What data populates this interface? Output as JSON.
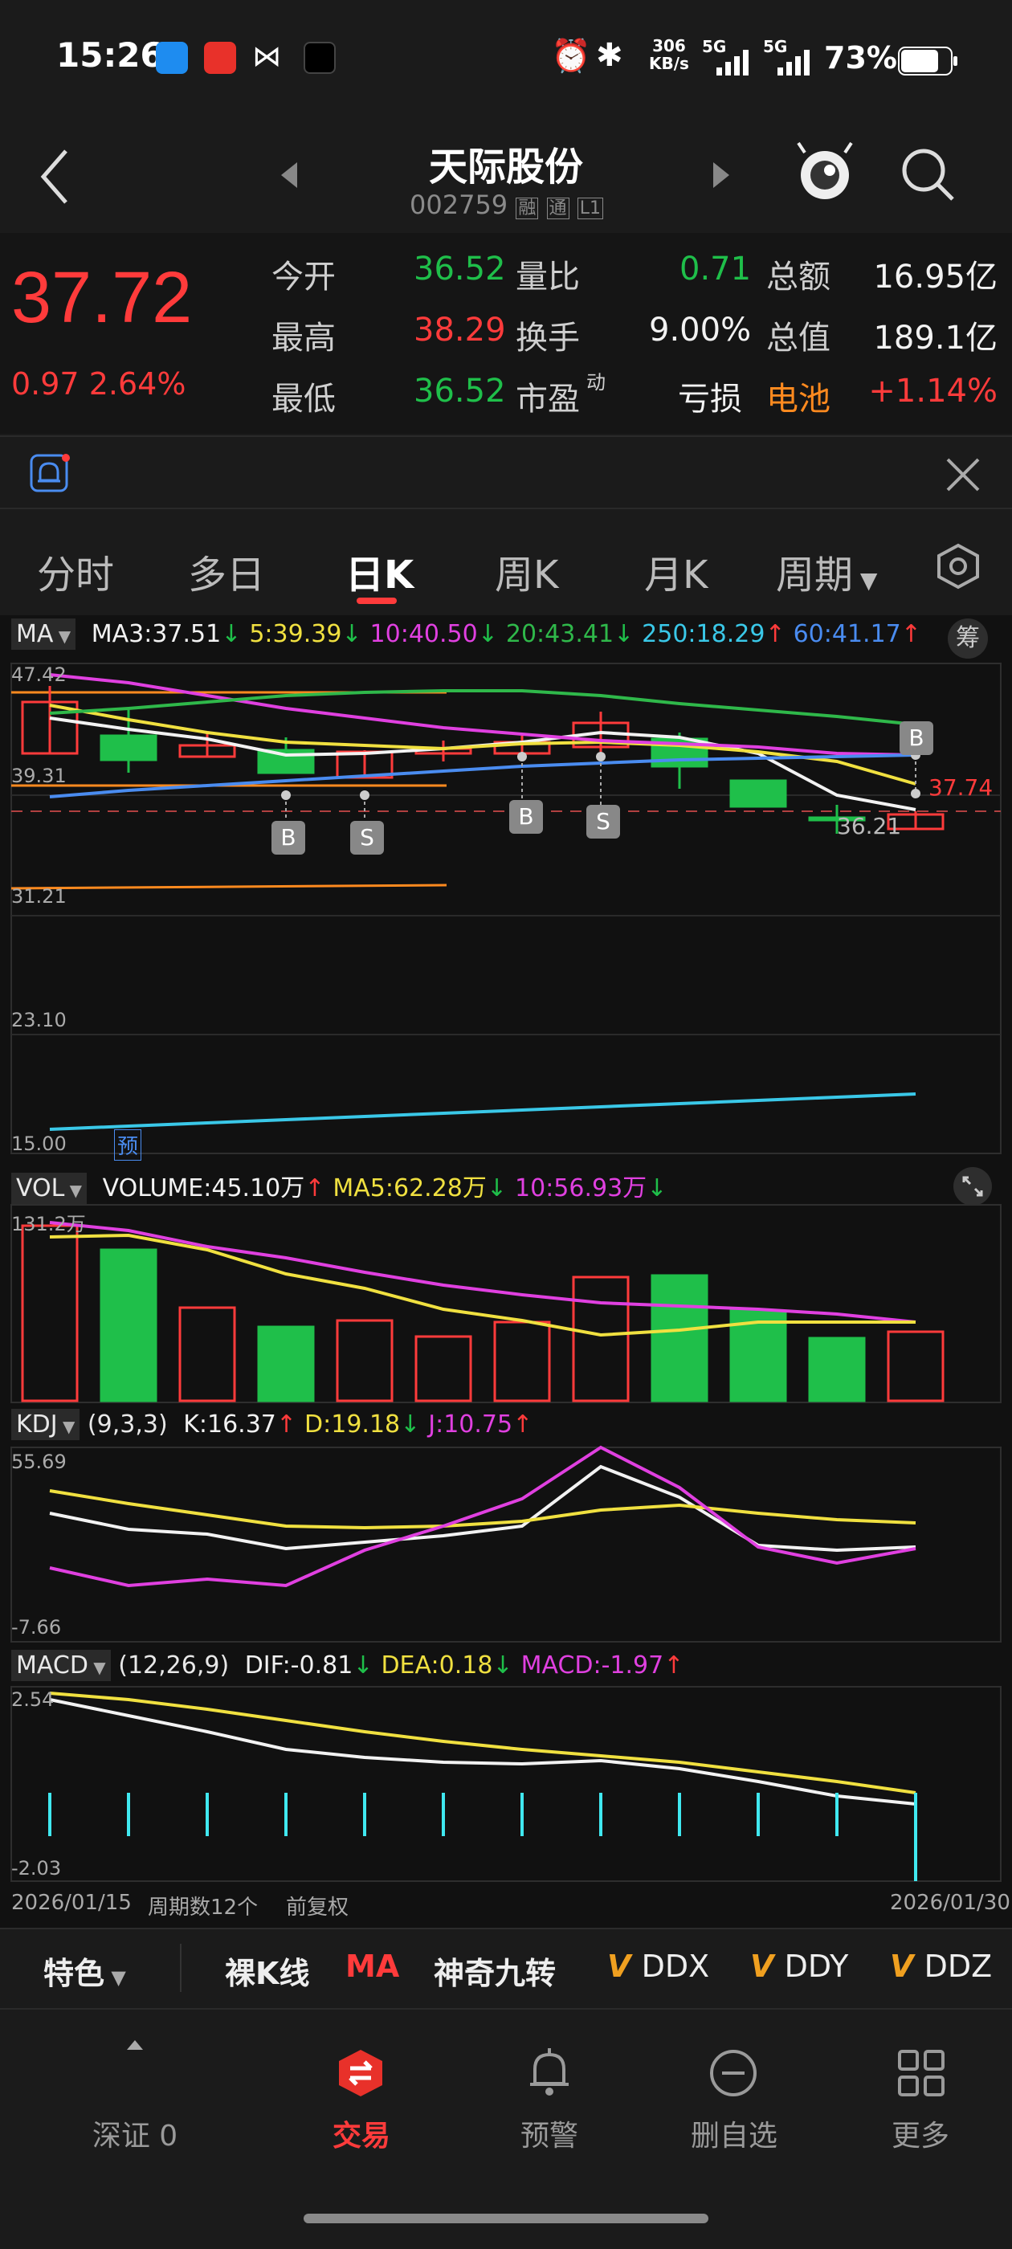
{
  "status": {
    "time": "15:26",
    "speed_top": "306",
    "speed_bottom": "KB/s",
    "net1": "5G",
    "net2": "5G",
    "battery": "73%"
  },
  "header": {
    "title": "天际股份",
    "code": "002759",
    "badge1": "融",
    "badge2": "通",
    "badge3": "L1"
  },
  "quote": {
    "price": "37.72",
    "change": "0.97",
    "change_pct": "2.64%",
    "rows": [
      {
        "l1": "今开",
        "v1": "36.52",
        "l2": "量比",
        "v2": "0.71",
        "l3": "总额",
        "v3": "16.95亿"
      },
      {
        "l1": "最高",
        "v1": "38.29",
        "l2": "换手",
        "v2": "9.00%",
        "l3": "总值",
        "v3": "189.1亿"
      },
      {
        "l1": "最低",
        "v1": "36.52",
        "l2": "市盈",
        "l2sup": "动",
        "v2": "亏损",
        "l3": "电池",
        "v3": "+1.14%"
      }
    ]
  },
  "tabs": [
    "分时",
    "多日",
    "日K",
    "周K",
    "月K",
    "周期"
  ],
  "ma": {
    "label": "MA",
    "items": [
      {
        "text": "MA3:37.51",
        "arrow": "↓",
        "color": "#f2f2f2",
        "acolor": "#1fbf4a"
      },
      {
        "text": "5:39.39",
        "arrow": "↓",
        "color": "#f0e040",
        "acolor": "#1fbf4a"
      },
      {
        "text": "10:40.50",
        "arrow": "↓",
        "color": "#e040e0",
        "acolor": "#1fbf4a"
      },
      {
        "text": "20:43.41",
        "arrow": "↓",
        "color": "#2fb84a",
        "acolor": "#1fbf4a"
      },
      {
        "text": "250:18.29",
        "arrow": "↑",
        "color": "#3ac8e8",
        "acolor": "#ff3b3b"
      },
      {
        "text": "60:41.17",
        "arrow": "↑",
        "color": "#4a8cf0",
        "acolor": "#ff3b3b"
      }
    ],
    "chip": "筹",
    "y_labels": [
      "47.42",
      "39.31",
      "31.21",
      "23.10",
      "15.00"
    ],
    "last_price": "37.74",
    "low_mark": "36.21",
    "pre_label": "预",
    "markers": [
      "B",
      "S",
      "B",
      "S",
      "B"
    ]
  },
  "vol": {
    "label": "VOL",
    "items": [
      {
        "text": "VOLUME:45.10万",
        "arrow": "↑",
        "color": "#f2f2f2",
        "acolor": "#ff3b3b"
      },
      {
        "text": "MA5:62.28万",
        "arrow": "↓",
        "color": "#f0e040",
        "acolor": "#1fbf4a"
      },
      {
        "text": "10:56.93万",
        "arrow": "↓",
        "color": "#e040e0",
        "acolor": "#1fbf4a"
      }
    ],
    "y_top": "131.2万"
  },
  "kdj": {
    "label": "KDJ",
    "params": "(9,3,3)",
    "items": [
      {
        "text": "K:16.37",
        "arrow": "↑",
        "color": "#f2f2f2",
        "acolor": "#ff3b3b"
      },
      {
        "text": "D:19.18",
        "arrow": "↓",
        "color": "#f0e040",
        "acolor": "#1fbf4a"
      },
      {
        "text": "J:10.75",
        "arrow": "↑",
        "color": "#e040e0",
        "acolor": "#ff3b3b"
      }
    ],
    "y_top": "55.69",
    "y_bottom": "-7.66"
  },
  "macd": {
    "label": "MACD",
    "params": "(12,26,9)",
    "items": [
      {
        "text": "DIF:-0.81",
        "arrow": "↓",
        "color": "#f2f2f2",
        "acolor": "#1fbf4a"
      },
      {
        "text": "DEA:0.18",
        "arrow": "↓",
        "color": "#f0e040",
        "acolor": "#1fbf4a"
      },
      {
        "text": "MACD:-1.97",
        "arrow": "↑",
        "color": "#e040e0",
        "acolor": "#ff3b3b"
      }
    ],
    "y_top": "2.54",
    "y_bottom": "-2.03"
  },
  "footer_axis": {
    "start": "2026/01/15",
    "count": "周期数12个",
    "adjust": "前复权",
    "end": "2026/01/30"
  },
  "toolbar": [
    "特色",
    "裸K线",
    "MA",
    "神奇九转",
    "DDX",
    "DDY",
    "DDZ"
  ],
  "bottom_nav": [
    {
      "label": "深证 0"
    },
    {
      "label": "交易"
    },
    {
      "label": "预警"
    },
    {
      "label": "删自选"
    },
    {
      "label": "更多"
    }
  ],
  "colors": {
    "up": "#ff3b3b",
    "down": "#1fbf4a",
    "ma5": "#f0e040",
    "ma10": "#e040e0",
    "ma20": "#2fb84a",
    "ma250": "#3ac8e8",
    "ma60": "#4a8cf0"
  }
}
